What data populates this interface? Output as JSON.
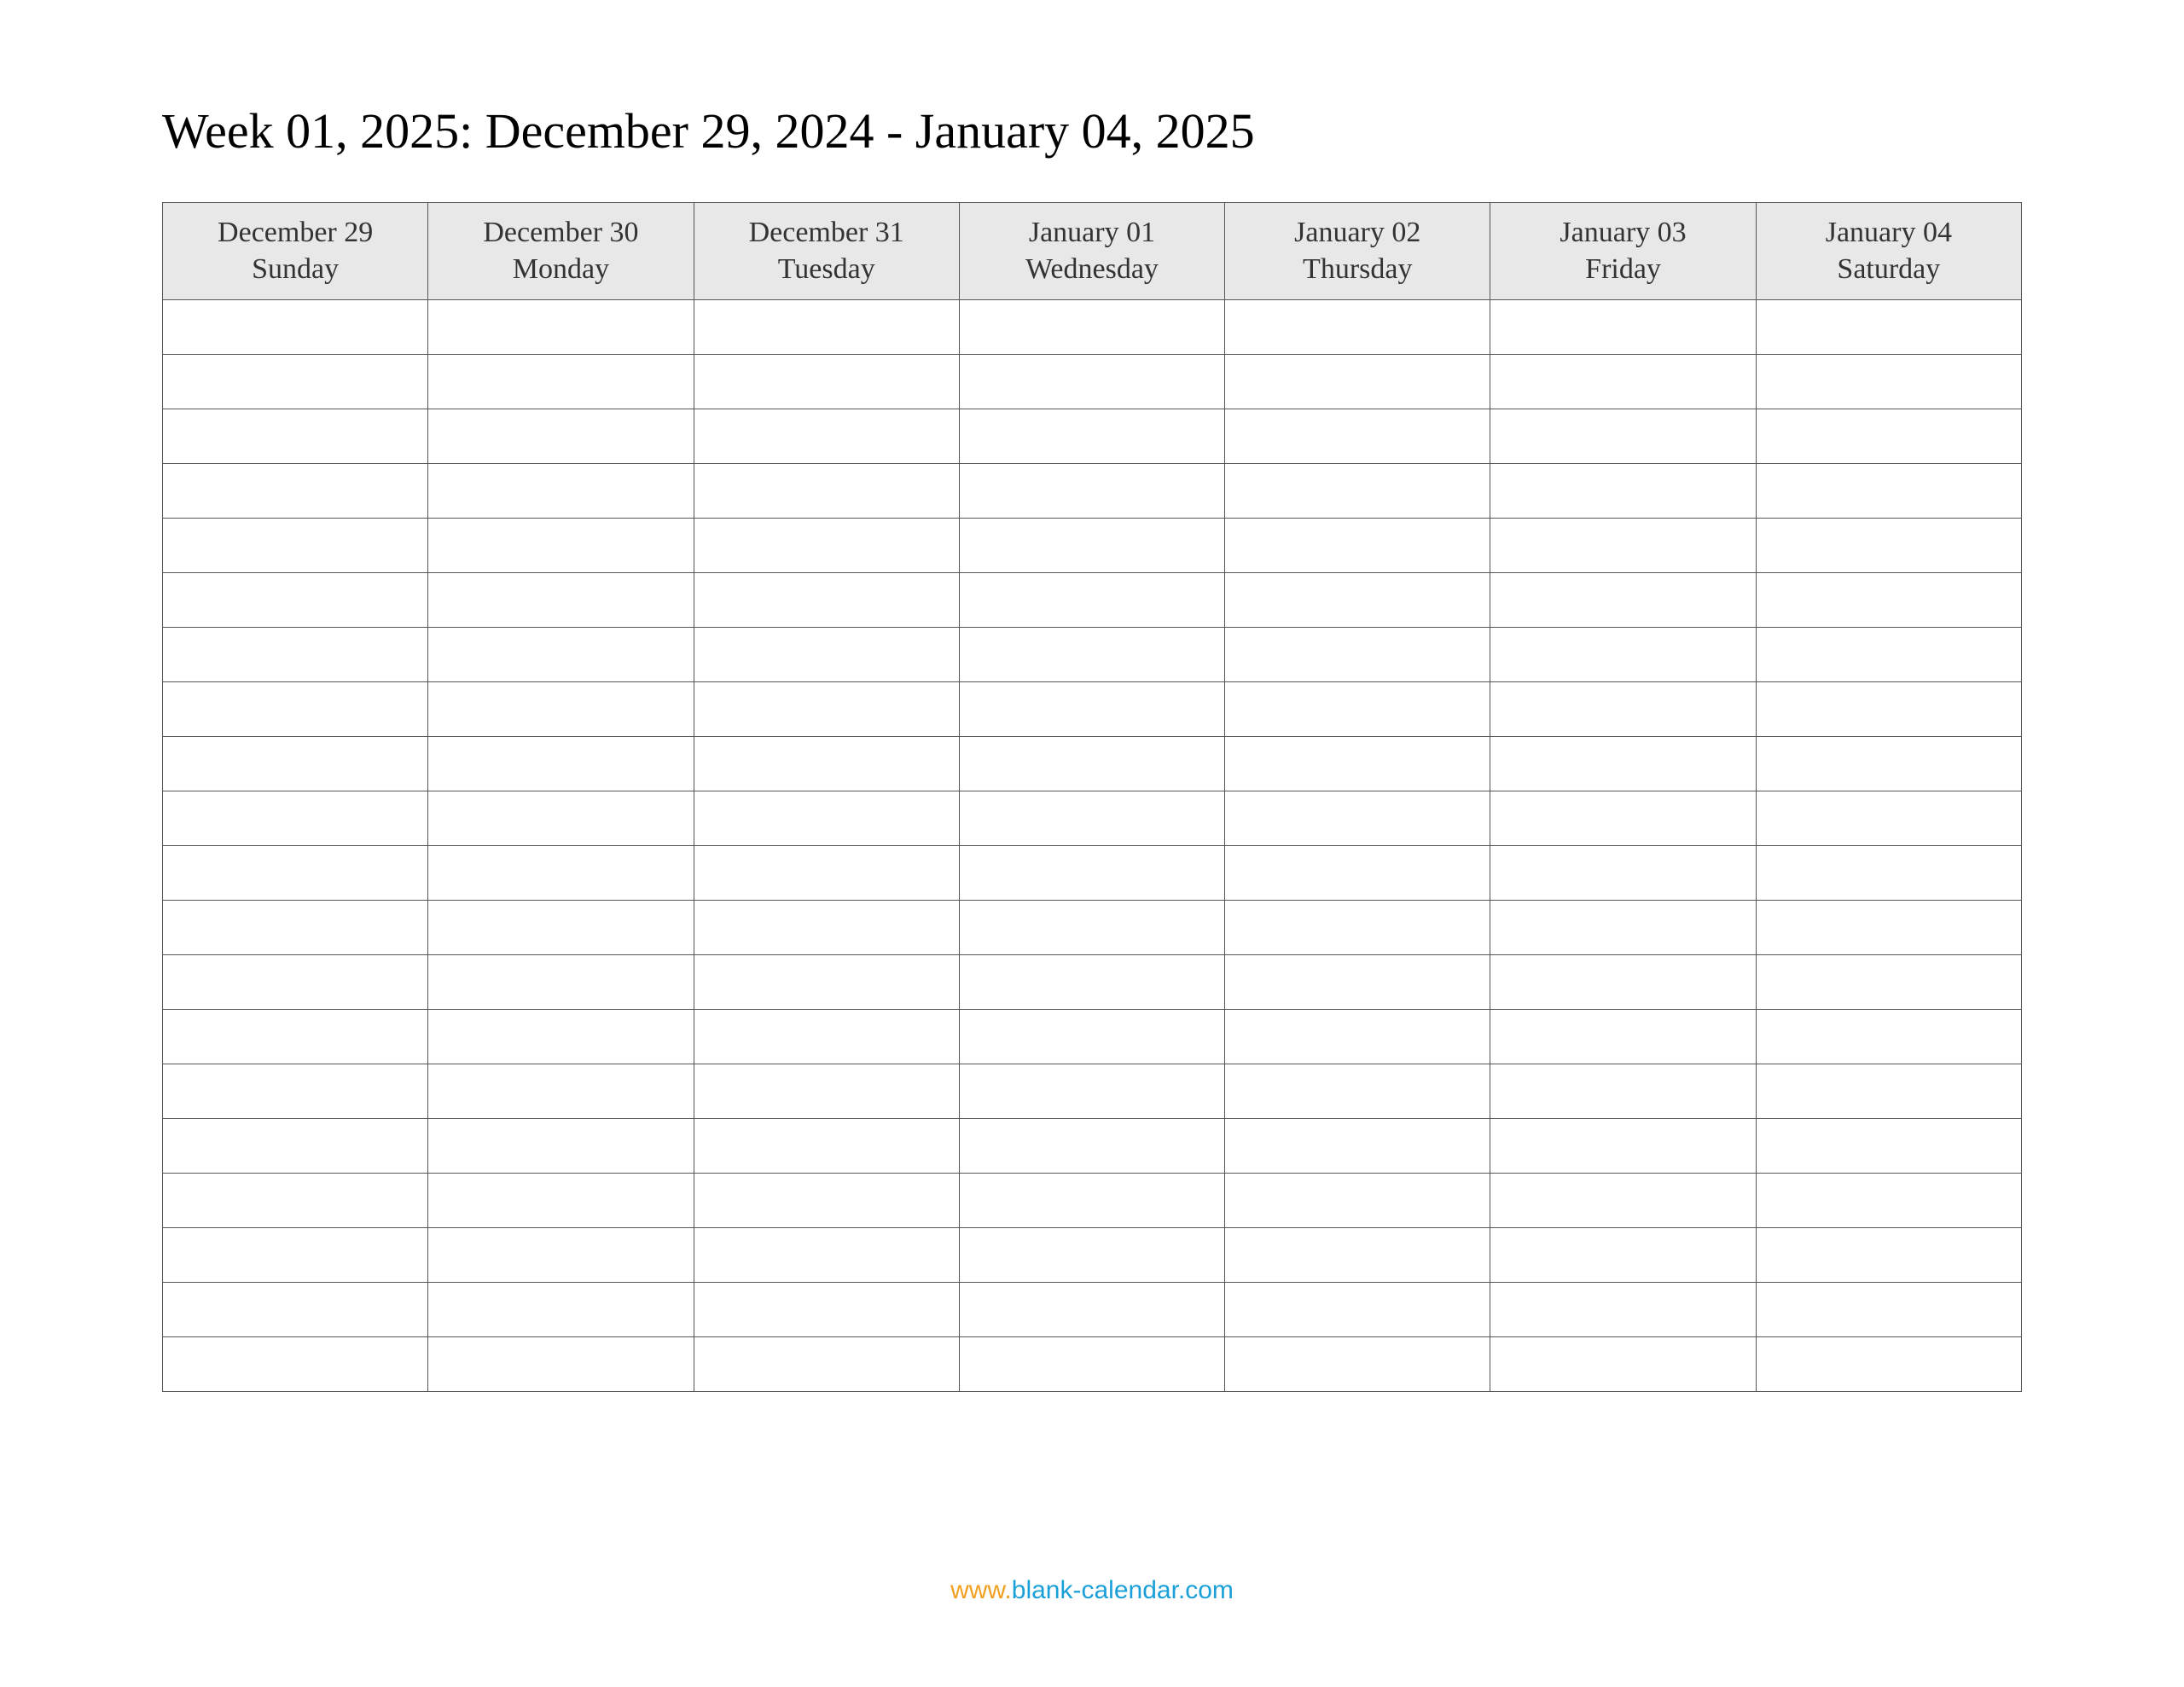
{
  "title": "Week 01, 2025: December 29, 2024 - January 04, 2025",
  "columns": [
    {
      "date": "December 29",
      "day": "Sunday"
    },
    {
      "date": "December 30",
      "day": "Monday"
    },
    {
      "date": "December 31",
      "day": "Tuesday"
    },
    {
      "date": "January 01",
      "day": "Wednesday"
    },
    {
      "date": "January 02",
      "day": "Thursday"
    },
    {
      "date": "January 03",
      "day": "Friday"
    },
    {
      "date": "January 04",
      "day": "Saturday"
    }
  ],
  "body_rows": 20,
  "footer": {
    "www": "www.",
    "domain": "blank-calendar.com"
  }
}
